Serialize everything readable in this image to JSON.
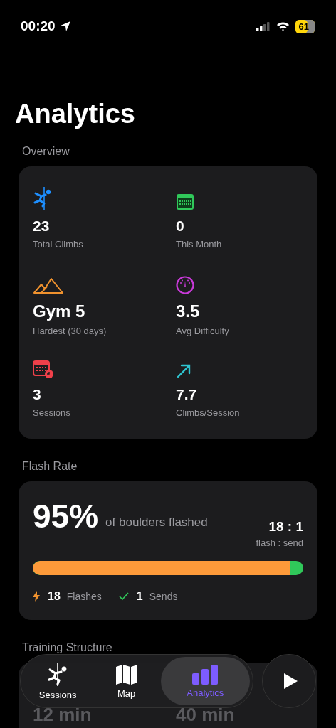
{
  "status_bar": {
    "time": "00:20",
    "battery": "61"
  },
  "title": "Analytics",
  "overview": {
    "heading": "Overview",
    "stats": [
      {
        "kind": "climber",
        "color": "#1e8fff",
        "value": "23",
        "label": "Total Climbs"
      },
      {
        "kind": "calendar",
        "color": "#30c85a",
        "value": "0",
        "label": "This Month"
      },
      {
        "kind": "mountains",
        "color": "#f0922e",
        "value": "Gym 5",
        "label": "Hardest (30 days)"
      },
      {
        "kind": "gauge",
        "color": "#c83ad8",
        "value": "3.5",
        "label": "Avg Difficulty"
      },
      {
        "kind": "calendar-clock",
        "color": "#f0404a",
        "value": "3",
        "label": "Sessions"
      },
      {
        "kind": "arrow",
        "color": "#2ec4d0",
        "value": "7.7",
        "label": "Climbs/Session"
      }
    ]
  },
  "flash_rate": {
    "heading": "Flash Rate",
    "percent": "95%",
    "caption": "of boulders flashed",
    "ratio": "18 : 1",
    "ratio_label": "flash : send",
    "level": 0.95,
    "flashes_count": "18",
    "flashes_label": "Flashes",
    "sends_count": "1",
    "sends_label": "Sends"
  },
  "training": {
    "heading": "Training Structure",
    "values": [
      "12 min",
      "40 min"
    ]
  },
  "tab_bar": {
    "tabs": [
      {
        "kind": "climber",
        "label": "Sessions",
        "selected": false
      },
      {
        "kind": "map",
        "label": "Map",
        "selected": false
      },
      {
        "kind": "chart",
        "label": "Analytics",
        "selected": true
      }
    ]
  }
}
